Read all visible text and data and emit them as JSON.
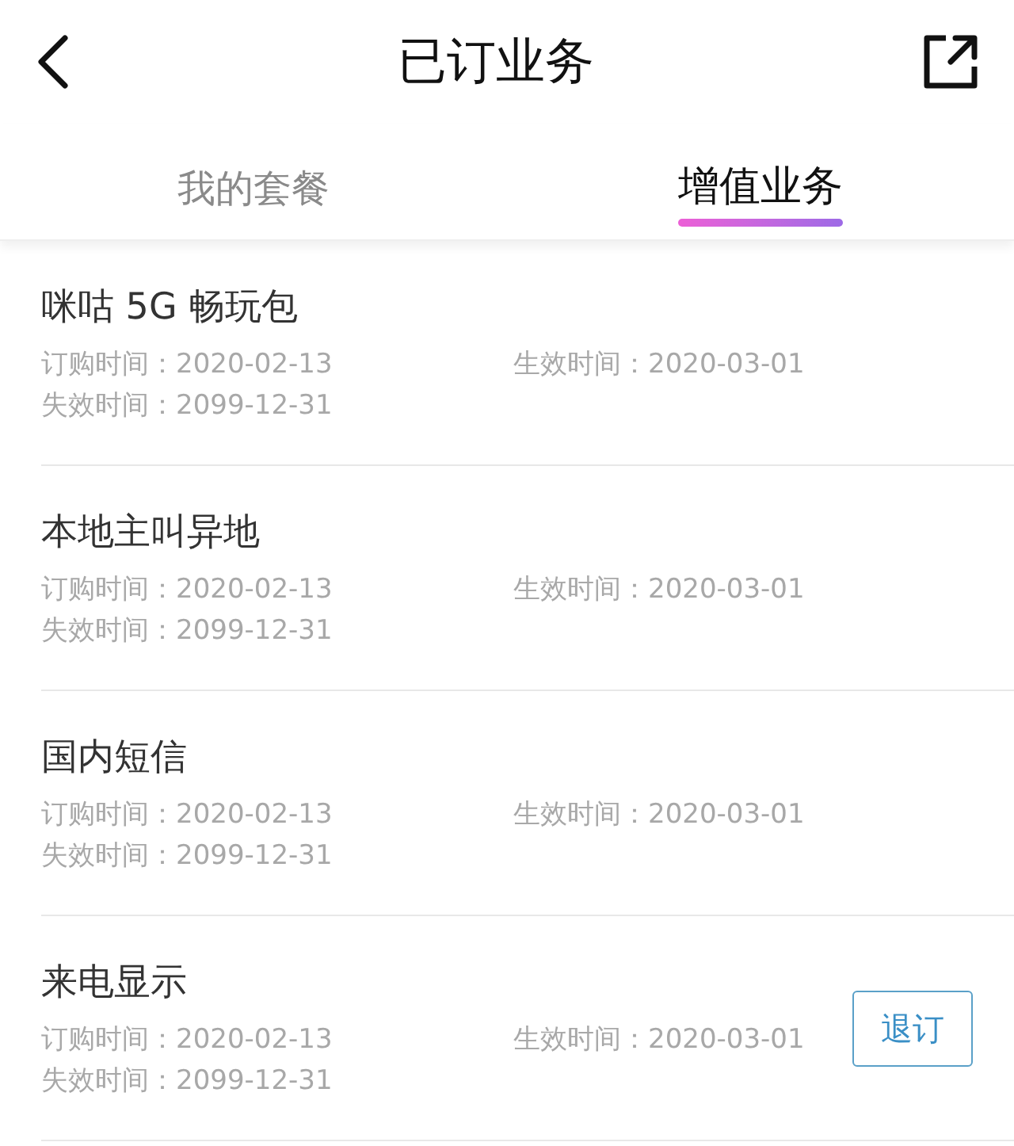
{
  "header": {
    "title": "已订业务"
  },
  "tabs": [
    {
      "label": "我的套餐",
      "selected": false
    },
    {
      "label": "增值业务",
      "selected": true
    }
  ],
  "services": [
    {
      "name": "咪咕 5G 畅玩包",
      "ordered": "订购时间：2020-02-13",
      "effective": "生效时间：2020-03-01",
      "expires": "失效时间：2099-12-31"
    },
    {
      "name": "本地主叫异地",
      "ordered": "订购时间：2020-02-13",
      "effective": "生效时间：2020-03-01",
      "expires": "失效时间：2099-12-31"
    },
    {
      "name": "国内短信",
      "ordered": "订购时间：2020-02-13",
      "effective": "生效时间：2020-03-01",
      "expires": "失效时间：2099-12-31"
    },
    {
      "name": "来电显示",
      "ordered": "订购时间：2020-02-13",
      "effective": "生效时间：2020-03-01",
      "expires": "失效时间：2099-12-31",
      "button": "退订"
    }
  ]
}
